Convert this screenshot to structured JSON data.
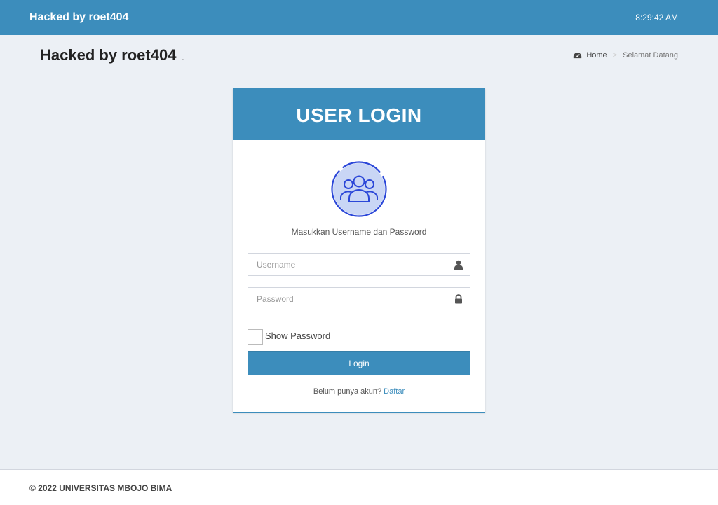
{
  "header": {
    "brand": "Hacked by roet404",
    "clock": "8:29:42 AM"
  },
  "content_header": {
    "title": "Hacked by roet404",
    "title_small": ".",
    "breadcrumb": {
      "home_icon": "dashboard-icon",
      "home": "Home",
      "separator": ">",
      "current": "Selamat Datang"
    }
  },
  "login": {
    "title": "USER LOGIN",
    "avatar_icon": "users-group-icon",
    "hint": "Masukkan Username dan Password",
    "username_placeholder": "Username",
    "username_icon": "user-icon",
    "password_placeholder": "Password",
    "password_icon": "lock-icon",
    "show_password_label": "Show Password",
    "login_button": "Login",
    "register_text": "Belum punya akun?",
    "register_link": "Daftar"
  },
  "footer": {
    "copyright": "© 2022 UNIVERSITAS MBOJO BIMA"
  },
  "colors": {
    "primary": "#3c8dbc",
    "background": "#ecf0f5",
    "avatar_blue": "#2b47d8",
    "avatar_fill": "#c9d6f5"
  }
}
